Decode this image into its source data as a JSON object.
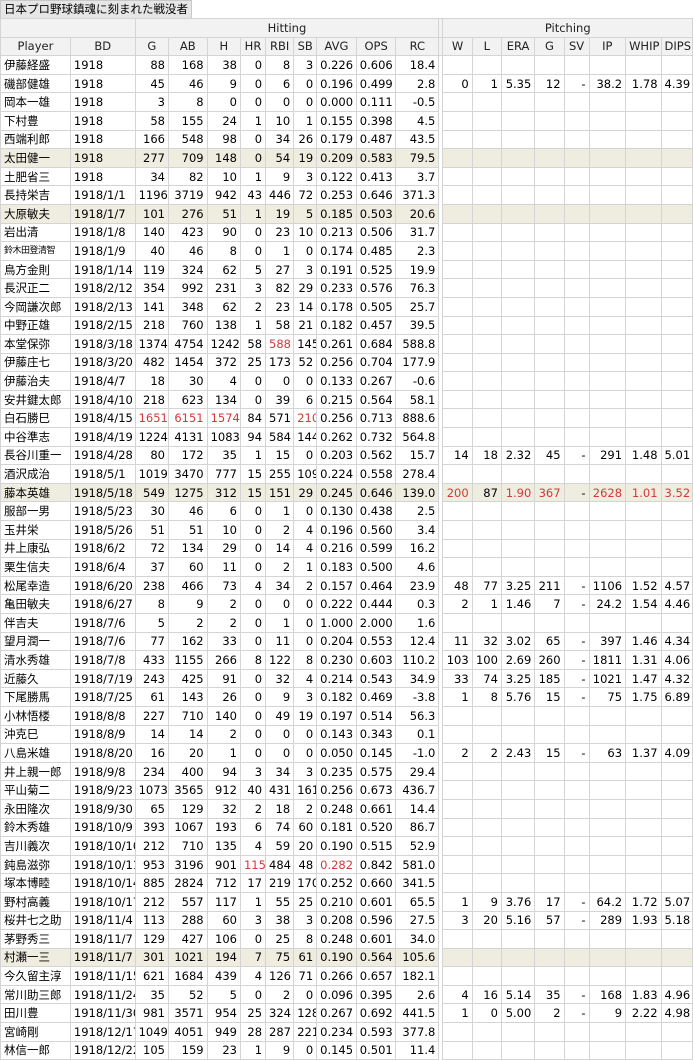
{
  "caption": "日本プロ野球鎮魂に刻まれた戦没者",
  "groups": {
    "hitting": "Hitting",
    "pitching": "Pitching"
  },
  "columns": {
    "player": "Player",
    "bd": "BD",
    "hitting": [
      "G",
      "AB",
      "H",
      "HR",
      "RBI",
      "SB",
      "AVG",
      "OPS",
      "RC"
    ],
    "pitching": [
      "W",
      "L",
      "ERA",
      "G",
      "SV",
      "IP",
      "WHIP",
      "DIPS"
    ]
  },
  "colors": {
    "highlight_row": "#efece0",
    "leader_text": "#d23a3a",
    "header_bg": "#f2f2f2"
  },
  "rows": [
    {
      "name": "伊藤経盛",
      "bd": "1918",
      "h": [
        "88",
        "168",
        "38",
        "0",
        "8",
        "3",
        "0.226",
        "0.606",
        "18.4"
      ],
      "p": [
        "",
        "",
        "",
        "",
        "",
        "",
        "",
        ""
      ]
    },
    {
      "name": "磯部健雄",
      "bd": "1918",
      "h": [
        "45",
        "46",
        "9",
        "0",
        "6",
        "0",
        "0.196",
        "0.499",
        "2.8"
      ],
      "p": [
        "0",
        "1",
        "5.35",
        "12",
        "-",
        "38.2",
        "1.78",
        "4.39"
      ]
    },
    {
      "name": "岡本一雄",
      "bd": "1918",
      "h": [
        "3",
        "8",
        "0",
        "0",
        "0",
        "0",
        "0.000",
        "0.111",
        "-0.5"
      ],
      "p": [
        "",
        "",
        "",
        "",
        "",
        "",
        "",
        ""
      ]
    },
    {
      "name": "下村豊",
      "bd": "1918",
      "h": [
        "58",
        "155",
        "24",
        "1",
        "10",
        "1",
        "0.155",
        "0.398",
        "4.5"
      ],
      "p": [
        "",
        "",
        "",
        "",
        "",
        "",
        "",
        ""
      ]
    },
    {
      "name": "西端利郎",
      "bd": "1918",
      "h": [
        "166",
        "548",
        "98",
        "0",
        "34",
        "26",
        "0.179",
        "0.487",
        "43.5"
      ],
      "p": [
        "",
        "",
        "",
        "",
        "",
        "",
        "",
        ""
      ]
    },
    {
      "name": "太田健一",
      "bd": "1918",
      "hl": true,
      "h": [
        "277",
        "709",
        "148",
        "0",
        "54",
        "19",
        "0.209",
        "0.583",
        "79.5"
      ],
      "p": [
        "",
        "",
        "",
        "",
        "",
        "",
        "",
        ""
      ]
    },
    {
      "name": "土肥省三",
      "bd": "1918",
      "h": [
        "34",
        "82",
        "10",
        "1",
        "9",
        "3",
        "0.122",
        "0.413",
        "3.7"
      ],
      "p": [
        "",
        "",
        "",
        "",
        "",
        "",
        "",
        ""
      ]
    },
    {
      "name": "長持栄吉",
      "bd": "1918/1/1",
      "h": [
        "1196",
        "3719",
        "942",
        "43",
        "446",
        "72",
        "0.253",
        "0.646",
        "371.3"
      ],
      "p": [
        "",
        "",
        "",
        "",
        "",
        "",
        "",
        ""
      ]
    },
    {
      "name": "大原敏夫",
      "bd": "1918/1/7",
      "hl": true,
      "h": [
        "101",
        "276",
        "51",
        "1",
        "19",
        "5",
        "0.185",
        "0.503",
        "20.6"
      ],
      "p": [
        "",
        "",
        "",
        "",
        "",
        "",
        "",
        ""
      ]
    },
    {
      "name": "岩出清",
      "bd": "1918/1/8",
      "h": [
        "140",
        "423",
        "90",
        "0",
        "23",
        "10",
        "0.213",
        "0.506",
        "31.7"
      ],
      "p": [
        "",
        "",
        "",
        "",
        "",
        "",
        "",
        ""
      ]
    },
    {
      "name": "鈴木田登清智",
      "bd": "1918/1/9",
      "small": true,
      "h": [
        "40",
        "46",
        "8",
        "0",
        "1",
        "0",
        "0.174",
        "0.485",
        "2.3"
      ],
      "p": [
        "",
        "",
        "",
        "",
        "",
        "",
        "",
        ""
      ]
    },
    {
      "name": "鳥方金則",
      "bd": "1918/1/14",
      "h": [
        "119",
        "324",
        "62",
        "5",
        "27",
        "3",
        "0.191",
        "0.525",
        "19.9"
      ],
      "p": [
        "",
        "",
        "",
        "",
        "",
        "",
        "",
        ""
      ]
    },
    {
      "name": "長沢正二",
      "bd": "1918/2/12",
      "h": [
        "354",
        "992",
        "231",
        "3",
        "82",
        "29",
        "0.233",
        "0.576",
        "76.3"
      ],
      "p": [
        "",
        "",
        "",
        "",
        "",
        "",
        "",
        ""
      ]
    },
    {
      "name": "今岡謙次郎",
      "bd": "1918/2/13",
      "h": [
        "141",
        "348",
        "62",
        "2",
        "23",
        "14",
        "0.178",
        "0.505",
        "25.7"
      ],
      "p": [
        "",
        "",
        "",
        "",
        "",
        "",
        "",
        ""
      ]
    },
    {
      "name": "中野正雄",
      "bd": "1918/2/15",
      "h": [
        "218",
        "760",
        "138",
        "1",
        "58",
        "21",
        "0.182",
        "0.457",
        "39.5"
      ],
      "p": [
        "",
        "",
        "",
        "",
        "",
        "",
        "",
        ""
      ]
    },
    {
      "name": "本堂保弥",
      "bd": "1918/3/18",
      "h": [
        "1374",
        "4754",
        "1242",
        "58",
        "588",
        "145",
        "0.261",
        "0.684",
        "588.8"
      ],
      "red": {
        "h": [
          4
        ]
      },
      "p": [
        "",
        "",
        "",
        "",
        "",
        "",
        "",
        ""
      ]
    },
    {
      "name": "伊藤庄七",
      "bd": "1918/3/20",
      "h": [
        "482",
        "1454",
        "372",
        "25",
        "173",
        "52",
        "0.256",
        "0.704",
        "177.9"
      ],
      "p": [
        "",
        "",
        "",
        "",
        "",
        "",
        "",
        ""
      ]
    },
    {
      "name": "伊藤治夫",
      "bd": "1918/4/7",
      "h": [
        "18",
        "30",
        "4",
        "0",
        "0",
        "0",
        "0.133",
        "0.267",
        "-0.6"
      ],
      "p": [
        "",
        "",
        "",
        "",
        "",
        "",
        "",
        ""
      ]
    },
    {
      "name": "安井鍵太郎",
      "bd": "1918/4/10",
      "h": [
        "218",
        "623",
        "134",
        "0",
        "39",
        "6",
        "0.215",
        "0.564",
        "58.1"
      ],
      "p": [
        "",
        "",
        "",
        "",
        "",
        "",
        "",
        ""
      ]
    },
    {
      "name": "白石勝巳",
      "bd": "1918/4/15",
      "h": [
        "1651",
        "6151",
        "1574",
        "84",
        "571",
        "210",
        "0.256",
        "0.713",
        "888.6"
      ],
      "red": {
        "h": [
          0,
          1,
          2,
          5
        ]
      },
      "p": [
        "",
        "",
        "",
        "",
        "",
        "",
        "",
        ""
      ]
    },
    {
      "name": "中谷準志",
      "bd": "1918/4/19",
      "h": [
        "1224",
        "4131",
        "1083",
        "94",
        "584",
        "144",
        "0.262",
        "0.732",
        "564.8"
      ],
      "p": [
        "",
        "",
        "",
        "",
        "",
        "",
        "",
        ""
      ]
    },
    {
      "name": "長谷川重一",
      "bd": "1918/4/28",
      "h": [
        "80",
        "172",
        "35",
        "1",
        "15",
        "0",
        "0.203",
        "0.562",
        "15.7"
      ],
      "p": [
        "14",
        "18",
        "2.32",
        "45",
        "-",
        "291",
        "1.48",
        "5.01"
      ]
    },
    {
      "name": "酒沢成治",
      "bd": "1918/5/1",
      "h": [
        "1019",
        "3470",
        "777",
        "15",
        "255",
        "109",
        "0.224",
        "0.558",
        "278.4"
      ],
      "p": [
        "",
        "",
        "",
        "",
        "",
        "",
        "",
        ""
      ]
    },
    {
      "name": "藤本英雄",
      "bd": "1918/5/18",
      "hl": true,
      "h": [
        "549",
        "1275",
        "312",
        "15",
        "151",
        "29",
        "0.245",
        "0.646",
        "139.0"
      ],
      "p": [
        "200",
        "87",
        "1.90",
        "367",
        "-",
        "2628",
        "1.01",
        "3.52"
      ],
      "red": {
        "p": [
          0,
          2,
          3,
          5,
          6,
          7
        ]
      }
    },
    {
      "name": "服部一男",
      "bd": "1918/5/23",
      "h": [
        "30",
        "46",
        "6",
        "0",
        "1",
        "0",
        "0.130",
        "0.438",
        "2.5"
      ],
      "p": [
        "",
        "",
        "",
        "",
        "",
        "",
        "",
        ""
      ]
    },
    {
      "name": "玉井栄",
      "bd": "1918/5/26",
      "h": [
        "51",
        "51",
        "10",
        "0",
        "2",
        "4",
        "0.196",
        "0.560",
        "3.4"
      ],
      "p": [
        "",
        "",
        "",
        "",
        "",
        "",
        "",
        ""
      ]
    },
    {
      "name": "井上康弘",
      "bd": "1918/6/2",
      "h": [
        "72",
        "134",
        "29",
        "0",
        "14",
        "4",
        "0.216",
        "0.599",
        "16.2"
      ],
      "p": [
        "",
        "",
        "",
        "",
        "",
        "",
        "",
        ""
      ]
    },
    {
      "name": "栗生信夫",
      "bd": "1918/6/4",
      "h": [
        "37",
        "60",
        "11",
        "0",
        "2",
        "1",
        "0.183",
        "0.500",
        "4.6"
      ],
      "p": [
        "",
        "",
        "",
        "",
        "",
        "",
        "",
        ""
      ]
    },
    {
      "name": "松尾幸造",
      "bd": "1918/6/20",
      "h": [
        "238",
        "466",
        "73",
        "4",
        "34",
        "2",
        "0.157",
        "0.464",
        "23.9"
      ],
      "p": [
        "48",
        "77",
        "3.25",
        "211",
        "-",
        "1106",
        "1.52",
        "4.57"
      ]
    },
    {
      "name": "亀田敏夫",
      "bd": "1918/6/27",
      "h": [
        "8",
        "9",
        "2",
        "0",
        "0",
        "0",
        "0.222",
        "0.444",
        "0.3"
      ],
      "p": [
        "2",
        "1",
        "1.46",
        "7",
        "-",
        "24.2",
        "1.54",
        "4.46"
      ]
    },
    {
      "name": "伴吉夫",
      "bd": "1918/7/6",
      "h": [
        "5",
        "2",
        "2",
        "0",
        "1",
        "0",
        "1.000",
        "2.000",
        "1.6"
      ],
      "p": [
        "",
        "",
        "",
        "",
        "",
        "",
        "",
        ""
      ]
    },
    {
      "name": "望月潤一",
      "bd": "1918/7/6",
      "h": [
        "77",
        "162",
        "33",
        "0",
        "11",
        "0",
        "0.204",
        "0.553",
        "12.4"
      ],
      "p": [
        "11",
        "32",
        "3.02",
        "65",
        "-",
        "397",
        "1.46",
        "4.34"
      ]
    },
    {
      "name": "清水秀雄",
      "bd": "1918/7/8",
      "h": [
        "433",
        "1155",
        "266",
        "8",
        "122",
        "8",
        "0.230",
        "0.603",
        "110.2"
      ],
      "p": [
        "103",
        "100",
        "2.69",
        "260",
        "-",
        "1811",
        "1.31",
        "4.06"
      ]
    },
    {
      "name": "近藤久",
      "bd": "1918/7/19",
      "h": [
        "243",
        "425",
        "91",
        "0",
        "32",
        "4",
        "0.214",
        "0.543",
        "34.9"
      ],
      "p": [
        "33",
        "74",
        "3.25",
        "185",
        "-",
        "1021",
        "1.47",
        "4.32"
      ]
    },
    {
      "name": "下尾勝馬",
      "bd": "1918/7/25",
      "h": [
        "61",
        "143",
        "26",
        "0",
        "9",
        "3",
        "0.182",
        "0.469",
        "-3.8"
      ],
      "p": [
        "1",
        "8",
        "5.76",
        "15",
        "-",
        "75",
        "1.75",
        "6.89"
      ]
    },
    {
      "name": "小林悟楼",
      "bd": "1918/8/8",
      "h": [
        "227",
        "710",
        "140",
        "0",
        "49",
        "19",
        "0.197",
        "0.514",
        "56.3"
      ],
      "p": [
        "",
        "",
        "",
        "",
        "",
        "",
        "",
        ""
      ]
    },
    {
      "name": "沖克巳",
      "bd": "1918/8/9",
      "h": [
        "14",
        "14",
        "2",
        "0",
        "0",
        "0",
        "0.143",
        "0.343",
        "0.1"
      ],
      "p": [
        "",
        "",
        "",
        "",
        "",
        "",
        "",
        ""
      ]
    },
    {
      "name": "八島米雄",
      "bd": "1918/8/20",
      "h": [
        "16",
        "20",
        "1",
        "0",
        "0",
        "0",
        "0.050",
        "0.145",
        "-1.0"
      ],
      "p": [
        "2",
        "2",
        "2.43",
        "15",
        "-",
        "63",
        "1.37",
        "4.09"
      ]
    },
    {
      "name": "井上親一郎",
      "bd": "1918/9/8",
      "h": [
        "234",
        "400",
        "94",
        "3",
        "34",
        "3",
        "0.235",
        "0.575",
        "29.4"
      ],
      "p": [
        "",
        "",
        "",
        "",
        "",
        "",
        "",
        ""
      ]
    },
    {
      "name": "平山菊二",
      "bd": "1918/9/23",
      "h": [
        "1073",
        "3565",
        "912",
        "40",
        "431",
        "161",
        "0.256",
        "0.673",
        "436.7"
      ],
      "p": [
        "",
        "",
        "",
        "",
        "",
        "",
        "",
        ""
      ]
    },
    {
      "name": "永田隆次",
      "bd": "1918/9/30",
      "h": [
        "65",
        "129",
        "32",
        "2",
        "18",
        "2",
        "0.248",
        "0.661",
        "14.4"
      ],
      "p": [
        "",
        "",
        "",
        "",
        "",
        "",
        "",
        ""
      ]
    },
    {
      "name": "鈴木秀雄",
      "bd": "1918/10/9",
      "h": [
        "393",
        "1067",
        "193",
        "6",
        "74",
        "60",
        "0.181",
        "0.520",
        "86.7"
      ],
      "p": [
        "",
        "",
        "",
        "",
        "",
        "",
        "",
        ""
      ]
    },
    {
      "name": "吉川義次",
      "bd": "1918/10/10",
      "h": [
        "212",
        "710",
        "135",
        "4",
        "59",
        "20",
        "0.190",
        "0.515",
        "52.9"
      ],
      "p": [
        "",
        "",
        "",
        "",
        "",
        "",
        "",
        ""
      ]
    },
    {
      "name": "鈍島滋弥",
      "bd": "1918/10/11",
      "h": [
        "953",
        "3196",
        "901",
        "115",
        "484",
        "48",
        "0.282",
        "0.842",
        "581.0"
      ],
      "red": {
        "h": [
          3,
          6
        ]
      },
      "p": [
        "",
        "",
        "",
        "",
        "",
        "",
        "",
        ""
      ]
    },
    {
      "name": "塚本博睦",
      "bd": "1918/10/14",
      "h": [
        "885",
        "2824",
        "712",
        "17",
        "219",
        "170",
        "0.252",
        "0.660",
        "341.5"
      ],
      "p": [
        "",
        "",
        "",
        "",
        "",
        "",
        "",
        ""
      ]
    },
    {
      "name": "野村高義",
      "bd": "1918/10/17",
      "h": [
        "212",
        "557",
        "117",
        "1",
        "55",
        "25",
        "0.210",
        "0.601",
        "65.5"
      ],
      "p": [
        "1",
        "9",
        "3.76",
        "17",
        "-",
        "64.2",
        "1.72",
        "5.07"
      ]
    },
    {
      "name": "桜井七之助",
      "bd": "1918/11/4",
      "h": [
        "113",
        "288",
        "60",
        "3",
        "38",
        "3",
        "0.208",
        "0.596",
        "27.5"
      ],
      "p": [
        "3",
        "20",
        "5.16",
        "57",
        "-",
        "289",
        "1.93",
        "5.18"
      ]
    },
    {
      "name": "茅野秀三",
      "bd": "1918/11/7",
      "h": [
        "129",
        "427",
        "106",
        "0",
        "25",
        "8",
        "0.248",
        "0.601",
        "34.0"
      ],
      "p": [
        "",
        "",
        "",
        "",
        "",
        "",
        "",
        ""
      ]
    },
    {
      "name": "村瀬一三",
      "bd": "1918/11/7",
      "hl": true,
      "h": [
        "301",
        "1021",
        "194",
        "7",
        "75",
        "61",
        "0.190",
        "0.564",
        "105.6"
      ],
      "p": [
        "",
        "",
        "",
        "",
        "",
        "",
        "",
        ""
      ]
    },
    {
      "name": "今久留主淳",
      "bd": "1918/11/15",
      "h": [
        "621",
        "1684",
        "439",
        "4",
        "126",
        "71",
        "0.266",
        "0.657",
        "182.1"
      ],
      "p": [
        "",
        "",
        "",
        "",
        "",
        "",
        "",
        ""
      ]
    },
    {
      "name": "常川助三郎",
      "bd": "1918/11/24",
      "h": [
        "35",
        "52",
        "5",
        "0",
        "2",
        "0",
        "0.096",
        "0.395",
        "2.6"
      ],
      "p": [
        "4",
        "16",
        "5.14",
        "35",
        "-",
        "168",
        "1.83",
        "4.96"
      ]
    },
    {
      "name": "田川豊",
      "bd": "1918/11/30",
      "h": [
        "981",
        "3571",
        "954",
        "25",
        "324",
        "128",
        "0.267",
        "0.692",
        "441.5"
      ],
      "p": [
        "1",
        "0",
        "5.00",
        "2",
        "-",
        "9",
        "2.22",
        "4.98"
      ]
    },
    {
      "name": "宮崎剛",
      "bd": "1918/12/17",
      "h": [
        "1049",
        "4051",
        "949",
        "28",
        "287",
        "221",
        "0.234",
        "0.593",
        "377.8"
      ],
      "p": [
        "",
        "",
        "",
        "",
        "",
        "",
        "",
        ""
      ]
    },
    {
      "name": "林信一郎",
      "bd": "1918/12/22",
      "h": [
        "105",
        "159",
        "23",
        "1",
        "9",
        "0",
        "0.145",
        "0.501",
        "11.4"
      ],
      "p": [
        "",
        "",
        "",
        "",
        "",
        "",
        "",
        ""
      ]
    }
  ]
}
